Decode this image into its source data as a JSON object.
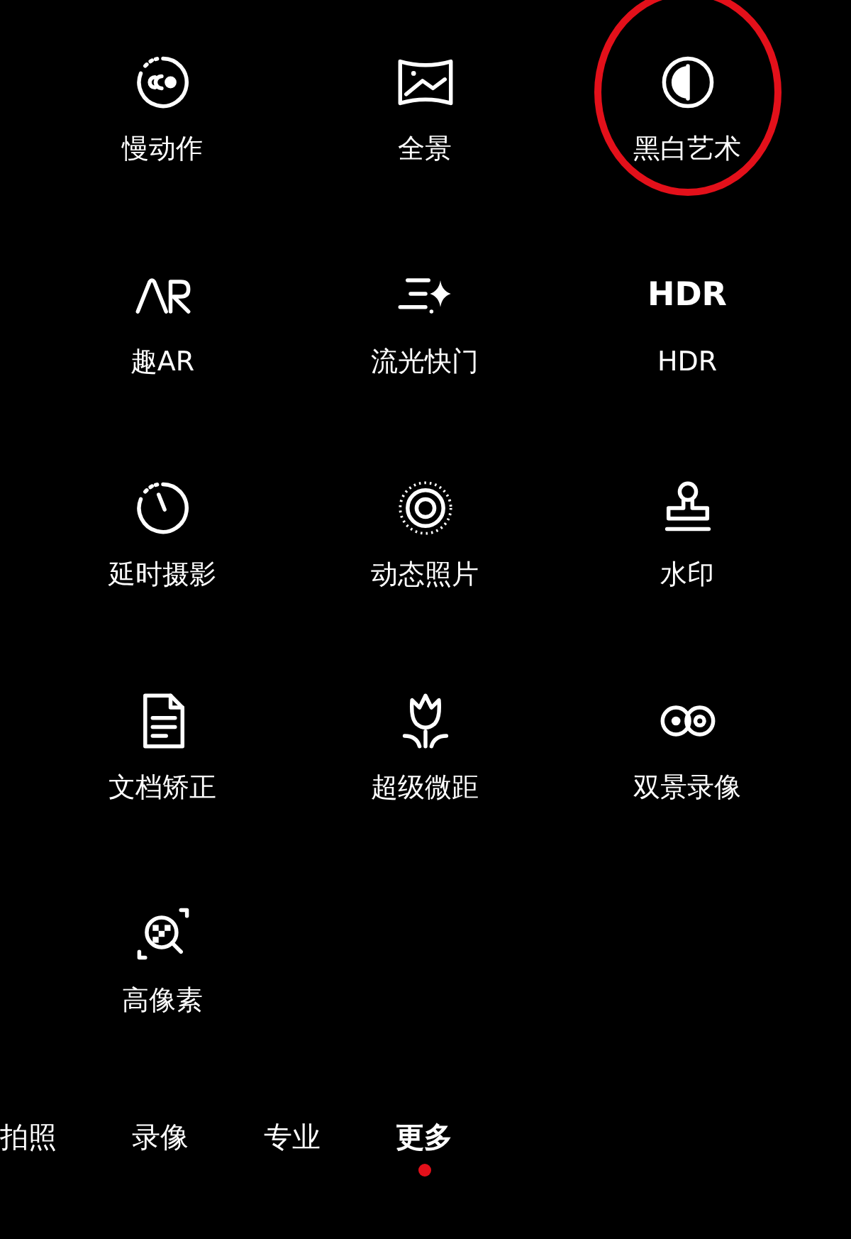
{
  "mode_rows": [
    {
      "modes": [
        {
          "label": "慢动作",
          "kind": "slowmo",
          "circled": false
        },
        {
          "label": "全景",
          "kind": "panorama",
          "circled": false
        },
        {
          "label": "黑白艺术",
          "kind": "monochrome",
          "circled": true
        }
      ]
    },
    {
      "modes": [
        {
          "label": "趣AR",
          "kind": "ar",
          "circled": false
        },
        {
          "label": "流光快门",
          "kind": "lightpainting",
          "circled": false
        },
        {
          "label": "HDR",
          "kind": "text",
          "icon_text": "HDR",
          "circled": false
        }
      ]
    },
    {
      "modes": [
        {
          "label": "延时摄影",
          "kind": "timelapse",
          "circled": false
        },
        {
          "label": "动态照片",
          "kind": "moving",
          "circled": false
        },
        {
          "label": "水印",
          "kind": "stamp",
          "circled": false
        }
      ]
    },
    {
      "modes": [
        {
          "label": "文档矫正",
          "kind": "document",
          "circled": false
        },
        {
          "label": "超级微距",
          "kind": "flower",
          "circled": false
        },
        {
          "label": "双景录像",
          "kind": "dualview",
          "circled": false
        }
      ]
    },
    {
      "modes": [
        {
          "label": "高像素",
          "kind": "highres",
          "circled": false
        }
      ]
    }
  ],
  "tabs": [
    {
      "label": "拍照",
      "selected": false
    },
    {
      "label": "录像",
      "selected": false
    },
    {
      "label": "专业",
      "selected": false
    },
    {
      "label": "更多",
      "selected": true
    }
  ]
}
